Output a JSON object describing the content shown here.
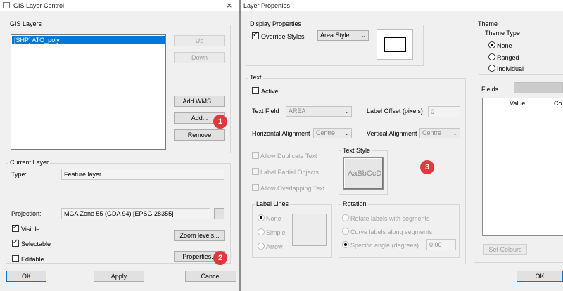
{
  "gis_window": {
    "title": "GIS Layer Control",
    "close_glyph": "×",
    "layers_group": "GIS Layers",
    "layers": [
      "[SHP] ATO_poly"
    ],
    "buttons": {
      "up": "Up",
      "down": "Down",
      "add_wms": "Add WMS...",
      "add": "Add...",
      "remove": "Remove",
      "zoom_levels": "Zoom levels...",
      "properties": "Properties...",
      "browse": "...",
      "ok": "OK",
      "apply": "Apply",
      "cancel": "Cancel"
    },
    "current_layer_group": "Current Layer",
    "type_label": "Type:",
    "type_value": "Feature layer",
    "projection_label": "Projection:",
    "projection_value": "MGA Zone 55 (GDA 94) [EPSG 28355]",
    "checks": {
      "visible": "Visible",
      "selectable": "Selectable",
      "editable": "Editable"
    }
  },
  "props_window": {
    "title": "Layer Properties",
    "display_group": "Display Properties",
    "override_styles": "Override Styles",
    "area_style": "Area Style",
    "text_group": "Text",
    "active": "Active",
    "text_field_label": "Text Field",
    "text_field_value": "AREA",
    "label_offset_label": "Label Offset (pixels)",
    "label_offset_value": "0",
    "h_align_label": "Horizontal Alignment",
    "h_align_value": "Centre",
    "v_align_label": "Vertical Alignment",
    "v_align_value": "Centre",
    "allow_duplicate": "Allow Duplicate Text",
    "label_partial": "Label Partial Objects",
    "allow_overlapping": "Allow Overlapping Text",
    "text_style_group": "Text Style",
    "text_style_sample": "AaBbCcD",
    "label_lines_group": "Label Lines",
    "label_lines": {
      "none": "None",
      "simple": "Simple",
      "arrow": "Arrow"
    },
    "rotation_group": "Rotation",
    "rotation": {
      "rotate": "Rotate labels with segments",
      "curve": "Curve labels along segments",
      "specific": "Specific angle (degrees)"
    },
    "angle_value": "0.00",
    "theme_group": "Theme",
    "theme_type_group": "Theme Type",
    "theme_types": {
      "none": "None",
      "ranged": "Ranged",
      "individual": "Individual"
    },
    "fields_label": "Fields",
    "table_headers": [
      "Value",
      "Co"
    ],
    "set_colours": "Set Colours",
    "ok": "OK"
  },
  "annotations": {
    "badge1": "1",
    "badge2": "2",
    "badge3": "3"
  },
  "colors": {
    "selection": "#0078d7",
    "badge": "#e0383d",
    "dialog_bg": "#f0f0f0"
  }
}
